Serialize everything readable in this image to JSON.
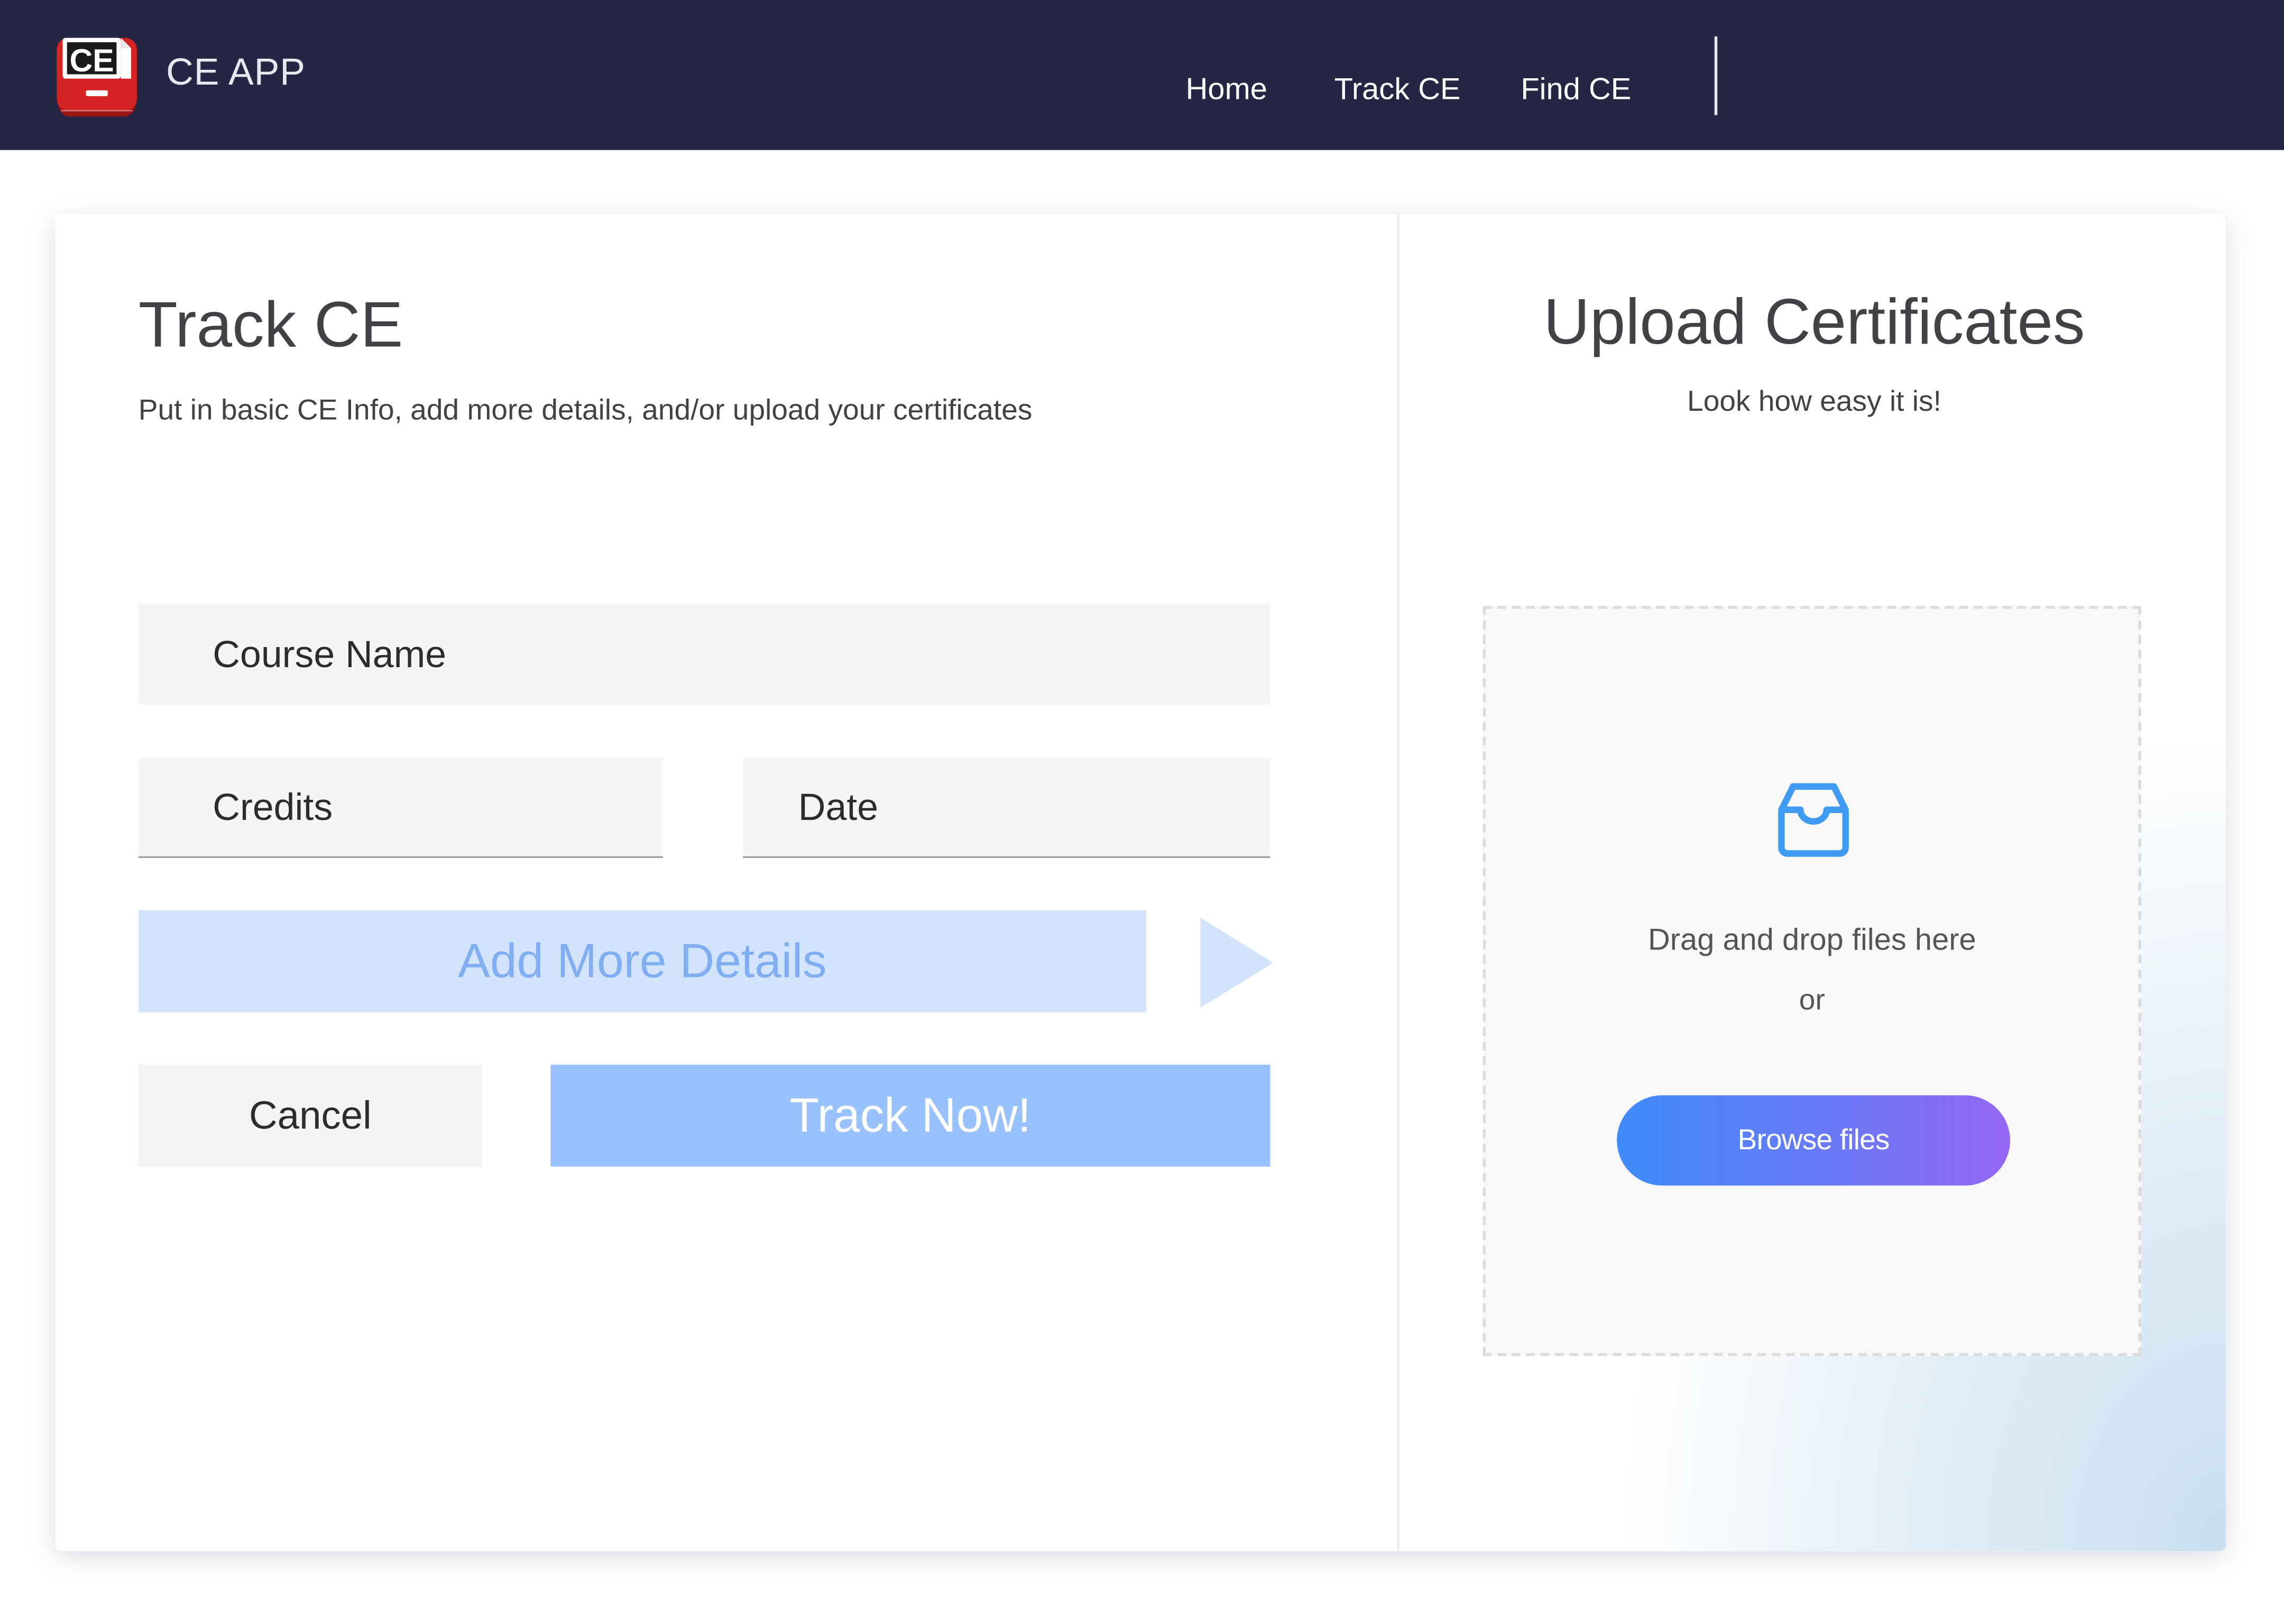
{
  "navbar": {
    "logo_text": "CE",
    "brand": "CE APP",
    "links": [
      {
        "label": "Home"
      },
      {
        "label": "Track CE"
      },
      {
        "label": "Find CE"
      }
    ],
    "background_color": "#242643"
  },
  "track_form": {
    "title": "Track CE",
    "subtitle": "Put in basic CE Info, add more details, and/or upload your certificates",
    "fields": {
      "course_name": {
        "placeholder": "Course Name",
        "value": ""
      },
      "credits": {
        "placeholder": "Credits",
        "value": ""
      },
      "date": {
        "placeholder": "Date",
        "value": ""
      }
    },
    "add_details_label": "Add More Details",
    "add_details_icon": "play-arrow-icon",
    "cancel_label": "Cancel",
    "track_now_label": "Track Now!",
    "colors": {
      "add_details_bg": "#d1e4fb",
      "add_details_text": "#81aef0",
      "track_now_bg": "#99c1fb"
    }
  },
  "upload": {
    "title": "Upload Certificates",
    "subtitle": "Look how easy it is!",
    "dropzone": {
      "icon": "inbox-icon",
      "drag_text": "Drag and drop files here",
      "or_text": "or",
      "browse_label": "Browse files"
    },
    "colors": {
      "icon": "#3f9bf2",
      "browse_gradient_start": "#3f8bf8",
      "browse_gradient_end": "#9466f3"
    }
  }
}
